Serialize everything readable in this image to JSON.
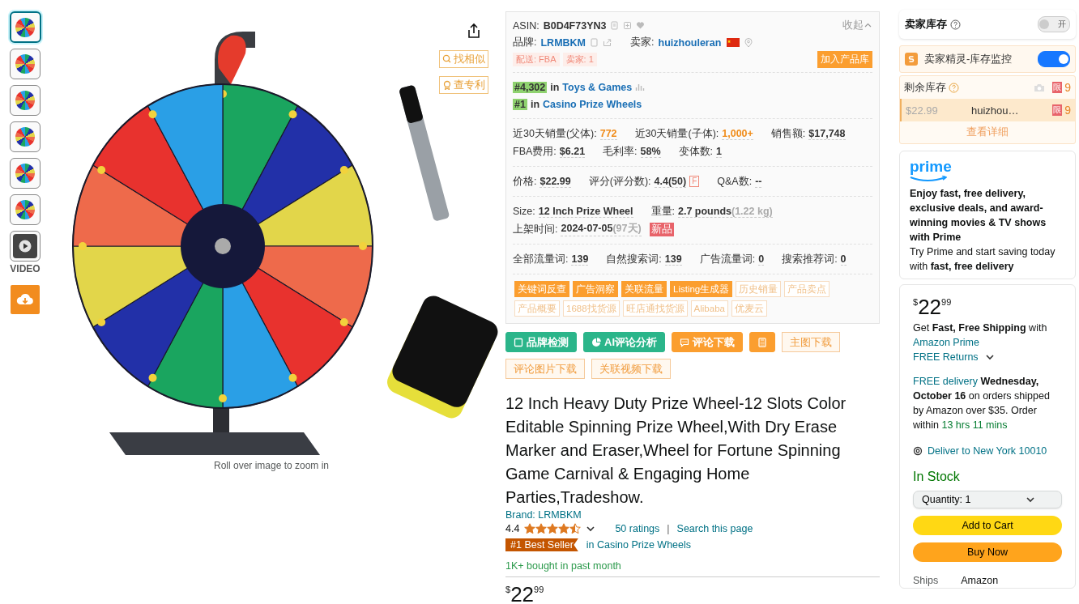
{
  "gallery": {
    "thumbnails": [
      {
        "kind": "photo",
        "selected": true
      },
      {
        "kind": "photo",
        "selected": false
      },
      {
        "kind": "photo",
        "selected": false
      },
      {
        "kind": "photo",
        "selected": false
      },
      {
        "kind": "photo",
        "selected": false
      },
      {
        "kind": "photo",
        "selected": false
      },
      {
        "kind": "video",
        "selected": false
      }
    ],
    "video_label": "VIDEO",
    "image_tools": [
      {
        "kind": "search",
        "label": "找相似"
      },
      {
        "kind": "patent",
        "label": "查专利"
      }
    ],
    "zoom_hint": "Roll over image to zoom in"
  },
  "plugin_panel": {
    "asin_label": "ASIN:",
    "asin": "B0D4F73YN3",
    "collapse": "收起",
    "brand_label": "品牌:",
    "brand": "LRMBKM",
    "seller_label": "卖家:",
    "seller": "huizhouleran",
    "tags": [
      "配送: FBA",
      "卖家: 1"
    ],
    "add_button": "加入产品库",
    "ranks": [
      {
        "rank": "#4,302",
        "joiner": "in",
        "category": "Toys & Games"
      },
      {
        "rank": "#1",
        "joiner": "in",
        "category": "Casino Prize Wheels"
      }
    ],
    "stat_groups": [
      [
        [
          {
            "label": "近30天销量(父体):",
            "value": "772",
            "highlight": true
          },
          {
            "label": "近30天销量(子体):",
            "value": "1,000+",
            "highlight": true
          },
          {
            "label": "销售额:",
            "value": "$17,748",
            "highlight": false
          }
        ],
        [
          {
            "label": "FBA费用:",
            "value": "$6.21",
            "highlight": false
          },
          {
            "label": "毛利率:",
            "value": "58%",
            "highlight": false
          },
          {
            "label": "变体数:",
            "value": "1",
            "highlight": false
          }
        ]
      ],
      [
        [
          {
            "label": "价格:",
            "value": "$22.99",
            "highlight": false
          },
          {
            "label": "评分(评分数):",
            "value": "4.4(50)",
            "badge": "F",
            "highlight": false
          },
          {
            "label": "Q&A数:",
            "value": "--",
            "highlight": false
          }
        ]
      ],
      [
        [
          {
            "label": "Size:",
            "value": "12 Inch Prize Wheel",
            "highlight": false
          },
          {
            "label": "重量:",
            "value": "2.7 pounds",
            "note": "(1.22 kg)",
            "highlight": false
          }
        ],
        [
          {
            "label": "上架时间:",
            "value": "2024-07-05",
            "note": "(97天)",
            "tag": "新品",
            "highlight": false
          }
        ]
      ],
      [
        [
          {
            "label": "全部流量词:",
            "value": "139",
            "highlight": false
          },
          {
            "label": "自然搜索词:",
            "value": "139",
            "highlight": false
          },
          {
            "label": "广告流量词:",
            "value": "0",
            "highlight": false
          },
          {
            "label": "搜索推荐词:",
            "value": "0",
            "highlight": false
          }
        ]
      ]
    ],
    "tools": [
      {
        "label": "关键词反查",
        "kind": "primary"
      },
      {
        "label": "广告洞察",
        "kind": "primary"
      },
      {
        "label": "关联流量",
        "kind": "primary"
      },
      {
        "label": "Listing生成器",
        "kind": "primary"
      },
      {
        "label": "历史销量",
        "kind": "secondary"
      },
      {
        "label": "产品卖点",
        "kind": "secondary"
      },
      {
        "label": "产品概要",
        "kind": "secondary"
      },
      {
        "label": "1688找货源",
        "kind": "secondary"
      },
      {
        "label": "旺店通找货源",
        "kind": "secondary"
      },
      {
        "label": "Alibaba",
        "kind": "secondary"
      },
      {
        "label": "优麦云",
        "kind": "secondary"
      }
    ]
  },
  "actions": [
    {
      "kind": "brand_check",
      "label": "品牌检测"
    },
    {
      "kind": "ai_review",
      "label": "AI评论分析"
    },
    {
      "kind": "review_download",
      "label": "评论下载"
    },
    {
      "kind": "calculator"
    },
    {
      "kind": "download",
      "label": "主图下载"
    },
    {
      "kind": "download",
      "label": "评论图片下载"
    },
    {
      "kind": "download",
      "label": "关联视频下载"
    }
  ],
  "product": {
    "title": "12 Inch Heavy Duty Prize Wheel-12 Slots Color Editable Spinning Prize Wheel,With Dry Erase Marker and Eraser,Wheel for Fortune Spinning Game Carnival & Engaging Home Parties,Tradeshow.",
    "brand": "Brand: LRMBKM",
    "rating": "4.4",
    "stars": 4.5,
    "ratings": "50 ratings",
    "separator": "|",
    "search_page": "Search this page",
    "badge": "#1 Best Seller",
    "badge_category": "in Casino Prize Wheels",
    "bought": "1K+ bought in past month",
    "price": {
      "symbol": "$",
      "whole": "22",
      "fraction": "99"
    }
  },
  "seller_inventory": {
    "title": "卖家库存",
    "toggle_label": "开",
    "on": false
  },
  "inventory_monitor": {
    "title": "卖家精灵-库存监控",
    "on": true
  },
  "stock": {
    "title": "剩余库存",
    "badge": "限",
    "count": "9",
    "rows": [
      {
        "price": "$22.99",
        "seller": "huizhou…",
        "badge": "限",
        "count": "9"
      }
    ],
    "link": "查看详细"
  },
  "prime": {
    "logo": "prime",
    "headline": "Enjoy fast, free delivery, exclusive deals, and award-winning movies & TV shows with Prime",
    "body": "Try Prime and start saving today with **fast, free delivery**"
  },
  "buy_box": {
    "price": {
      "symbol": "$",
      "whole": "22",
      "fraction": "99"
    },
    "shipping": "Get **Fast, Free Shipping** with",
    "prime_link": "Amazon Prime",
    "returns": "FREE Returns",
    "delivery_prefix": "FREE delivery",
    "delivery": " **Wednesday, October 16** on orders shipped by Amazon over $35. Order within ",
    "countdown": "13 hrs 11 mins",
    "location": "Deliver to New York 10010",
    "availability": "In Stock",
    "quantity_label": "Quantity:",
    "quantity": "1",
    "buttons": [
      {
        "kind": "cart",
        "label": "Add to Cart"
      },
      {
        "kind": "buy",
        "label": "Buy Now"
      }
    ],
    "ships_label": "Ships",
    "ships_value": "Amazon"
  }
}
